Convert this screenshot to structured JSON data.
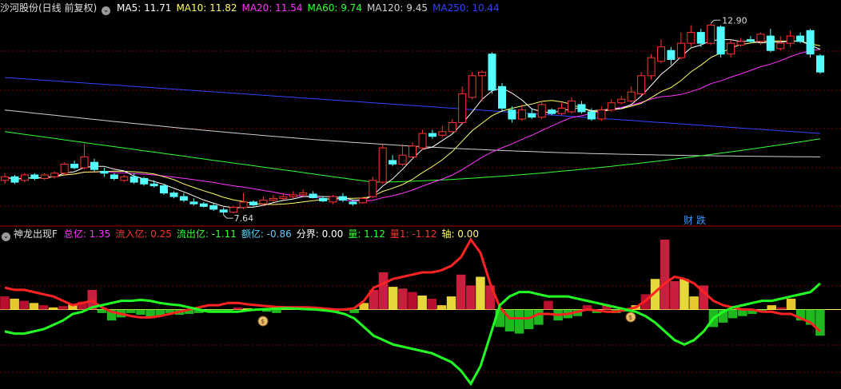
{
  "main_panel": {
    "stock_label": "沙河股份(日线 前复权)",
    "ma_items": [
      {
        "label": "MA5: 11.71",
        "color": "#ffffff"
      },
      {
        "label": "MA10: 11.82",
        "color": "#ffff66"
      },
      {
        "label": "MA20: 11.54",
        "color": "#ff33ff"
      },
      {
        "label": "MA60: 9.74",
        "color": "#33ff33"
      },
      {
        "label": "MA120: 9.45",
        "color": "#d0d0d0"
      },
      {
        "label": "MA250: 10.44",
        "color": "#3344ff"
      }
    ],
    "high_label": "12.90",
    "low_label": "7.64",
    "event_label": "财",
    "event_label2": "跌"
  },
  "indicator_panel": {
    "name": "神龙出现F",
    "items": [
      {
        "label": "总亿: 1.35",
        "color": "#ff33ff"
      },
      {
        "label": "流入亿: 0.25",
        "color": "#ff3333"
      },
      {
        "label": "流出亿: -1.11",
        "color": "#33ff33"
      },
      {
        "label": "额亿: -0.86",
        "color": "#66ccff"
      },
      {
        "label": "分界: 0.00",
        "color": "#ffffff"
      },
      {
        "label": "量: 1.12",
        "color": "#33ff33"
      },
      {
        "label": "量1: -1.12",
        "color": "#ff3333"
      },
      {
        "label": "轴: 0.00",
        "color": "#ffff66"
      }
    ]
  },
  "colors": {
    "up": "#ff3333",
    "down": "#54ffff",
    "grid": "#7a0000",
    "ma5": "#ffffff",
    "ma10": "#ffff66",
    "ma20": "#ff33ff",
    "ma60": "#33ff33",
    "ma120": "#d0d0d0",
    "ma250": "#3344ff",
    "inflow_line": "#ff2222",
    "outflow_line": "#22ff22"
  },
  "chart_data": [
    {
      "type": "candlestick",
      "title": "沙河股份(日线 前复权)",
      "ylim": [
        7.4,
        13.2
      ],
      "high": 12.9,
      "low": 7.64,
      "candles": [
        [
          8.6,
          8.7,
          8.8,
          8.5
        ],
        [
          8.7,
          8.55,
          8.75,
          8.5
        ],
        [
          8.6,
          8.75,
          8.8,
          8.55
        ],
        [
          8.75,
          8.65,
          8.8,
          8.6
        ],
        [
          8.65,
          8.75,
          8.8,
          8.6
        ],
        [
          8.7,
          8.8,
          8.85,
          8.65
        ],
        [
          8.8,
          9.05,
          9.1,
          8.75
        ],
        [
          9.05,
          8.95,
          9.15,
          8.9
        ],
        [
          8.95,
          9.25,
          9.6,
          8.9
        ],
        [
          9.1,
          8.9,
          9.2,
          8.85
        ],
        [
          8.85,
          8.8,
          8.95,
          8.7
        ],
        [
          8.75,
          8.65,
          8.8,
          8.6
        ],
        [
          8.6,
          8.7,
          8.75,
          8.55
        ],
        [
          8.7,
          8.55,
          8.8,
          8.5
        ],
        [
          8.65,
          8.5,
          8.7,
          8.45
        ],
        [
          8.5,
          8.45,
          8.6,
          8.4
        ],
        [
          8.45,
          8.25,
          8.5,
          8.2
        ],
        [
          8.25,
          8.15,
          8.3,
          8.1
        ],
        [
          8.15,
          8.05,
          8.25,
          8.0
        ],
        [
          8.0,
          7.95,
          8.1,
          7.9
        ],
        [
          7.95,
          7.88,
          8.0,
          7.85
        ],
        [
          7.9,
          7.8,
          7.95,
          7.75
        ],
        [
          7.78,
          7.72,
          7.85,
          7.64
        ],
        [
          7.72,
          7.85,
          7.9,
          7.68
        ],
        [
          7.85,
          8.0,
          8.25,
          7.8
        ],
        [
          8.0,
          7.92,
          8.05,
          7.88
        ],
        [
          7.95,
          8.05,
          8.15,
          7.9
        ],
        [
          8.05,
          8.1,
          8.2,
          8.0
        ],
        [
          8.1,
          8.15,
          8.25,
          8.05
        ],
        [
          8.15,
          8.2,
          8.3,
          8.1
        ],
        [
          8.2,
          8.25,
          8.35,
          8.15
        ],
        [
          8.22,
          8.12,
          8.3,
          8.1
        ],
        [
          8.1,
          8.03,
          8.15,
          8.0
        ],
        [
          8.0,
          8.15,
          8.2,
          7.95
        ],
        [
          8.15,
          8.05,
          8.25,
          8.0
        ],
        [
          8.0,
          7.95,
          8.05,
          7.9
        ],
        [
          7.98,
          8.1,
          8.15,
          7.95
        ],
        [
          8.15,
          8.6,
          8.7,
          8.1
        ],
        [
          8.55,
          9.5,
          9.6,
          8.5
        ],
        [
          9.15,
          9.05,
          9.3,
          9.0
        ],
        [
          9.05,
          9.3,
          9.6,
          9.0
        ],
        [
          9.25,
          9.55,
          9.65,
          9.2
        ],
        [
          9.5,
          9.9,
          10.0,
          9.45
        ],
        [
          9.9,
          9.82,
          10.0,
          9.75
        ],
        [
          9.85,
          9.95,
          10.1,
          9.8
        ],
        [
          9.95,
          10.2,
          10.3,
          9.9
        ],
        [
          10.2,
          11.0,
          11.2,
          10.15
        ],
        [
          10.9,
          11.5,
          11.6,
          10.85
        ],
        [
          11.5,
          11.6,
          11.65,
          10.8
        ],
        [
          12.1,
          11.1,
          12.15,
          11.0
        ],
        [
          11.2,
          10.6,
          11.3,
          10.5
        ],
        [
          10.55,
          10.3,
          10.65,
          10.2
        ],
        [
          10.3,
          10.55,
          10.7,
          10.25
        ],
        [
          10.45,
          10.35,
          10.6,
          10.3
        ],
        [
          10.35,
          10.7,
          10.8,
          10.3
        ],
        [
          10.55,
          10.45,
          10.6,
          10.4
        ],
        [
          10.45,
          10.6,
          10.75,
          10.4
        ],
        [
          10.5,
          10.8,
          10.9,
          10.45
        ],
        [
          10.7,
          10.5,
          10.8,
          10.45
        ],
        [
          10.5,
          10.3,
          10.6,
          10.25
        ],
        [
          10.3,
          10.55,
          10.65,
          10.25
        ],
        [
          10.55,
          10.75,
          10.85,
          10.5
        ],
        [
          10.75,
          10.85,
          10.95,
          10.7
        ],
        [
          10.8,
          11.05,
          11.2,
          10.75
        ],
        [
          11.0,
          11.5,
          11.6,
          10.95
        ],
        [
          11.5,
          12.0,
          12.1,
          11.4
        ],
        [
          11.9,
          12.3,
          12.5,
          11.85
        ],
        [
          12.2,
          11.95,
          12.3,
          11.8
        ],
        [
          12.0,
          12.4,
          12.7,
          11.95
        ],
        [
          12.4,
          12.7,
          12.9,
          12.3
        ],
        [
          12.7,
          12.4,
          12.8,
          12.3
        ],
        [
          12.4,
          12.9,
          12.95,
          12.35
        ],
        [
          12.85,
          12.1,
          12.9,
          12.0
        ],
        [
          12.1,
          12.4,
          12.5,
          12.0
        ],
        [
          12.35,
          12.45,
          12.55,
          12.3
        ],
        [
          12.5,
          12.45,
          12.6,
          12.4
        ],
        [
          12.45,
          12.65,
          12.7,
          12.35
        ],
        [
          12.6,
          12.2,
          12.8,
          12.15
        ],
        [
          12.25,
          12.4,
          12.6,
          12.2
        ],
        [
          12.4,
          12.6,
          12.75,
          12.3
        ],
        [
          12.6,
          12.45,
          12.7,
          12.4
        ],
        [
          12.75,
          12.1,
          12.8,
          12.0
        ],
        [
          12.05,
          11.6,
          12.1,
          11.55
        ]
      ]
    },
    {
      "type": "bar_line",
      "title": "神龙出现F",
      "ylim": [
        -1.8,
        1.6
      ],
      "bars": [
        0.3,
        0.25,
        0.2,
        0.15,
        0.1,
        0.05,
        0.08,
        0.12,
        0.18,
        0.45,
        -0.08,
        -0.25,
        -0.18,
        -0.08,
        -0.12,
        -0.2,
        -0.15,
        -0.08,
        -0.12,
        -0.1,
        -0.08,
        -0.05,
        -0.06,
        -0.04,
        0.05,
        0.03,
        -0.03,
        -0.05,
        -0.08,
        0.04,
        0.06,
        0.04,
        0.03,
        0.02,
        -0.05,
        -0.03,
        -0.08,
        0.15,
        0.45,
        0.85,
        0.52,
        0.48,
        0.4,
        0.32,
        0.25,
        0.1,
        0.3,
        0.8,
        0.55,
        0.75,
        0.55,
        -0.4,
        -0.5,
        -0.55,
        -0.45,
        -0.35,
        0.2,
        -0.25,
        -0.2,
        -0.15,
        0.1,
        -0.08,
        0.1,
        -0.08,
        -0.05,
        0.1,
        0.35,
        0.7,
        1.6,
        0.65,
        0.7,
        0.3,
        0.55,
        -0.4,
        -0.3,
        -0.2,
        -0.15,
        -0.1,
        -0.05,
        0.1,
        0.05,
        0.25,
        -0.25,
        -0.35,
        -0.6
      ],
      "series": [
        {
          "name": "流入亿",
          "values": [
            0.5,
            0.45,
            0.45,
            0.4,
            0.35,
            0.3,
            0.2,
            0.1,
            0.15,
            0.2,
            0.05,
            -0.05,
            -0.1,
            -0.15,
            -0.18,
            -0.18,
            -0.15,
            -0.1,
            -0.05,
            0,
            0.05,
            0.1,
            0.1,
            0.15,
            0.15,
            0.12,
            0.1,
            0.08,
            0.06,
            0.05,
            0.05,
            0.05,
            0.04,
            0.02,
            0,
            0,
            0.03,
            0.2,
            0.5,
            0.6,
            0.7,
            0.75,
            0.8,
            0.85,
            0.85,
            0.9,
            1.0,
            1.2,
            1.6,
            1.3,
            0.6,
            0.05,
            -0.2,
            -0.2,
            -0.2,
            -0.1,
            -0.1,
            -0.12,
            -0.1,
            -0.05,
            0,
            -0.02,
            -0.05,
            -0.05,
            0,
            0.05,
            0.2,
            0.4,
            0.6,
            0.75,
            0.7,
            0.6,
            0.4,
            0.2,
            0.1,
            0.05,
            0,
            0,
            -0.05,
            -0.05,
            -0.1,
            -0.1,
            -0.2,
            -0.3,
            -0.5
          ]
        },
        {
          "name": "流出亿",
          "values": [
            -0.5,
            -0.55,
            -0.55,
            -0.5,
            -0.45,
            -0.35,
            -0.25,
            -0.1,
            -0.05,
            0.05,
            0.1,
            0.15,
            0.2,
            0.2,
            0.22,
            0.2,
            0.15,
            0.12,
            0.1,
            0.05,
            0,
            -0.05,
            -0.05,
            -0.05,
            -0.05,
            -0.02,
            0,
            0.01,
            0.02,
            0.03,
            0.02,
            0.01,
            0,
            -0.02,
            -0.05,
            -0.1,
            -0.2,
            -0.4,
            -0.6,
            -0.7,
            -0.8,
            -0.85,
            -0.9,
            -0.95,
            -1.0,
            -1.1,
            -1.2,
            -1.4,
            -1.7,
            -1.3,
            -0.6,
            0.1,
            0.3,
            0.4,
            0.4,
            0.35,
            0.3,
            0.3,
            0.3,
            0.25,
            0.2,
            0.15,
            0.1,
            0.05,
            0,
            -0.05,
            -0.15,
            -0.3,
            -0.5,
            -0.7,
            -0.8,
            -0.7,
            -0.5,
            -0.2,
            -0.05,
            0.05,
            0.1,
            0.15,
            0.2,
            0.2,
            0.25,
            0.3,
            0.35,
            0.4,
            0.6
          ]
        }
      ]
    }
  ]
}
